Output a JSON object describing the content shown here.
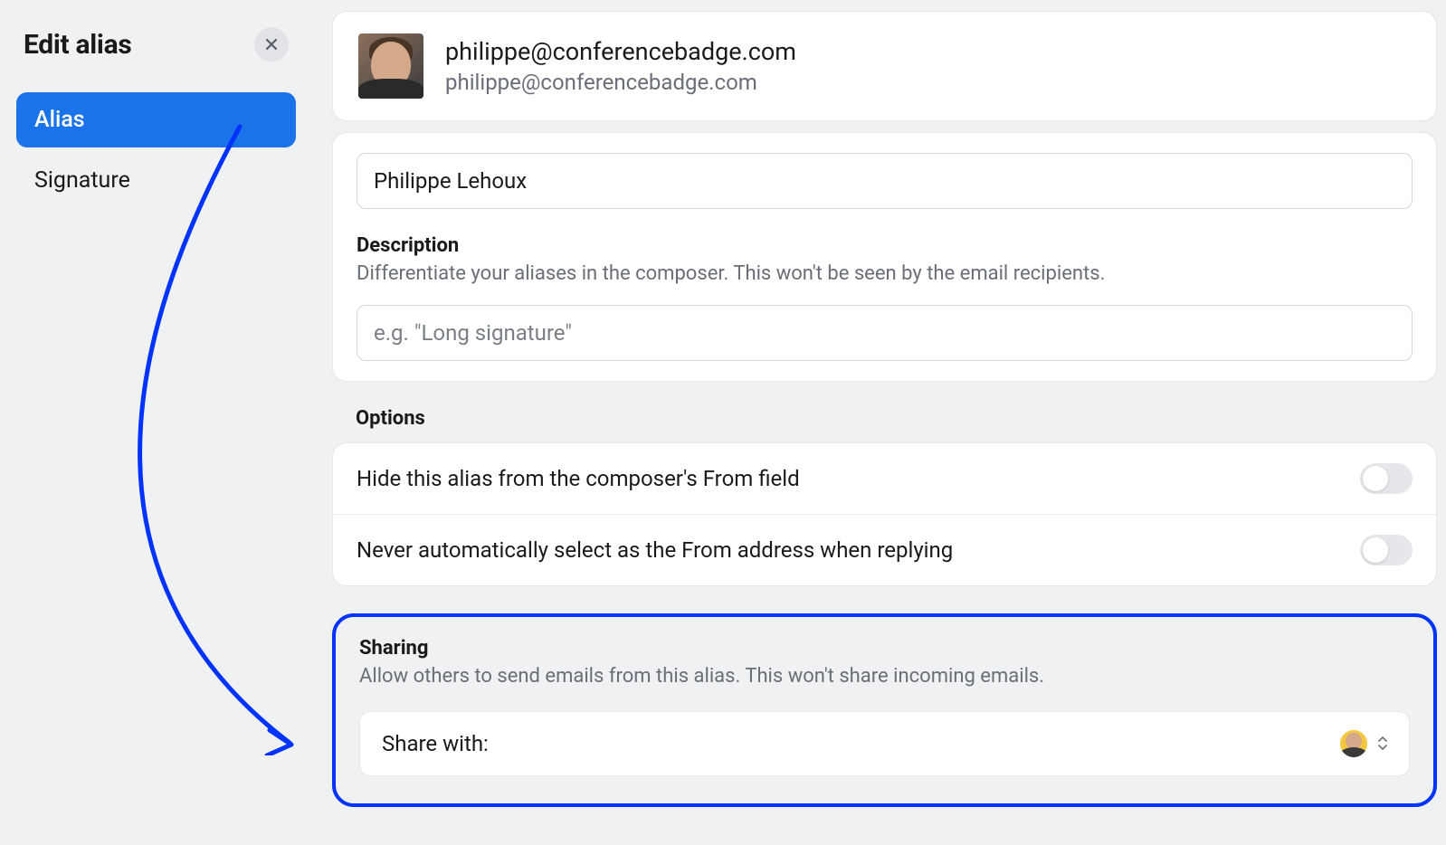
{
  "sidebar": {
    "title": "Edit alias",
    "items": [
      {
        "label": "Alias",
        "active": true
      },
      {
        "label": "Signature",
        "active": false
      }
    ]
  },
  "header": {
    "main": "philippe@conferencebadge.com",
    "sub": "philippe@conferencebadge.com"
  },
  "name_field": {
    "value": "Philippe Lehoux"
  },
  "description_field": {
    "label": "Description",
    "help": "Differentiate your aliases in the composer. This won't be seen by the email recipients.",
    "placeholder": "e.g. \"Long signature\""
  },
  "options": {
    "title": "Options",
    "rows": [
      {
        "label": "Hide this alias from the composer's From field"
      },
      {
        "label": "Never automatically select as the From address when replying"
      }
    ]
  },
  "sharing": {
    "title": "Sharing",
    "help": "Allow others to send emails from this alias. This won't share incoming emails.",
    "row_label": "Share with:"
  },
  "colors": {
    "accent": "#1a73e8",
    "highlight": "#0033ff"
  }
}
